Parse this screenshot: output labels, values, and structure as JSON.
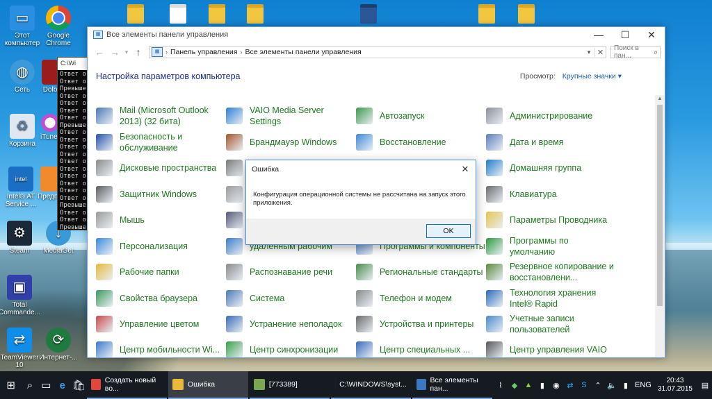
{
  "desktop_icons": [
    {
      "label": "Этот компьютер"
    },
    {
      "label": "Google Chrome"
    },
    {
      "label": "Сеть"
    },
    {
      "label": "Корзина"
    },
    {
      "label": "iTunes"
    },
    {
      "label": "Intel® AT Service ..."
    },
    {
      "label": "Предп..."
    },
    {
      "label": "Steam"
    },
    {
      "label": "MediaGet"
    },
    {
      "label": "Total Commande..."
    },
    {
      "label": "TeamViewer 10"
    },
    {
      "label": "Интернет-..."
    },
    {
      "label": "Dolb"
    }
  ],
  "console": {
    "title": "C:\\Wi",
    "lines": [
      "Ответ о",
      "Ответ о",
      "Превыше",
      "Ответ о",
      "Ответ о",
      "Ответ о",
      "Ответ о",
      "Превыше",
      "Ответ о",
      "Ответ о",
      "Ответ о",
      "Ответ о",
      "Ответ о",
      "Ответ о",
      "Ответ о",
      "Ответ о",
      "Ответ о",
      "Ответ о",
      "Превыше",
      "Ответ о",
      "Ответ о",
      "Превыше"
    ]
  },
  "window": {
    "title": "Все элементы панели управления",
    "address": {
      "crumb1": "Панель управления",
      "crumb2": "Все элементы панели управления"
    },
    "search_placeholder": "Поиск в пан...",
    "heading": "Настройка параметров компьютера",
    "view_label": "Просмотр:",
    "view_value": "Крупные значки"
  },
  "items": [
    {
      "label": "Mail (Microsoft Outlook 2013) (32 бита)",
      "color": "#4a78b5"
    },
    {
      "label": "VAIO Media Server Settings",
      "color": "#2b7fd4"
    },
    {
      "label": "Автозапуск",
      "color": "#3c9a4a"
    },
    {
      "label": "Администрирование",
      "color": "#8a8f99"
    },
    {
      "label": "Безопасность и обслуживание",
      "color": "#2451a8"
    },
    {
      "label": "Брандмауэр Windows",
      "color": "#a6552a"
    },
    {
      "label": "Восстановление",
      "color": "#3d8ad6"
    },
    {
      "label": "Дата и время",
      "color": "#5a7fb8"
    },
    {
      "label": "Дисковые пространства",
      "color": "#8a8a8a"
    },
    {
      "label": "",
      "color": "#777"
    },
    {
      "label": "",
      "color": "#777"
    },
    {
      "label": "Домашняя группа",
      "color": "#1e7bc8"
    },
    {
      "label": "Защитник Windows",
      "color": "#5c5c5c"
    },
    {
      "label": "",
      "color": "#999"
    },
    {
      "label": "",
      "color": "#999"
    },
    {
      "label": "Клавиатура",
      "color": "#6b6b6b"
    },
    {
      "label": "Мышь",
      "color": "#9a9a9a"
    },
    {
      "label": "",
      "color": "#557"
    },
    {
      "label": "",
      "color": "#557"
    },
    {
      "label": "Параметры Проводника",
      "color": "#e8c34a"
    },
    {
      "label": "Персонализация",
      "color": "#3a8ad8"
    },
    {
      "label": "удаленным рабочим",
      "color": "#3a7bc8"
    },
    {
      "label": "Программы и компоненты",
      "color": "#5a8ad0"
    },
    {
      "label": "Программы по умолчанию",
      "color": "#2d9a3c"
    },
    {
      "label": "Рабочие папки",
      "color": "#e6b93b"
    },
    {
      "label": "Распознавание речи",
      "color": "#8a8a8a"
    },
    {
      "label": "Региональные стандарты",
      "color": "#4a8a4a"
    },
    {
      "label": "Резервное копирование и восстановлени...",
      "color": "#5a8a3a"
    },
    {
      "label": "Свойства браузера",
      "color": "#3a9a5a"
    },
    {
      "label": "Система",
      "color": "#4a7ab8"
    },
    {
      "label": "Телефон и модем",
      "color": "#8a8a8a"
    },
    {
      "label": "Технология хранения Intel® Rapid",
      "color": "#2a6ab8"
    },
    {
      "label": "Управление цветом",
      "color": "#c84a4a"
    },
    {
      "label": "Устранение неполадок",
      "color": "#3a6ab8"
    },
    {
      "label": "Устройства и принтеры",
      "color": "#6a6a6a"
    },
    {
      "label": "Учетные записи пользователей",
      "color": "#4a8ac8"
    },
    {
      "label": "Центр мобильности Wi...",
      "color": "#3a7ac8"
    },
    {
      "label": "Центр синхронизации",
      "color": "#3aa04a"
    },
    {
      "label": "Центр специальных ...",
      "color": "#3a6ab8"
    },
    {
      "label": "Центр управления VAIO",
      "color": "#555"
    }
  ],
  "dialog": {
    "title": "Ошибка",
    "message": "Конфигурация операционной системы не рассчитана на запуск этого приложения.",
    "ok": "OK"
  },
  "taskbar": {
    "tasks": [
      {
        "label": "Создать новый во...",
        "color": "#e0473a"
      },
      {
        "label": "Ошибка",
        "color": "#e8b93b"
      },
      {
        "label": "[773389]",
        "color": "#7aa850"
      },
      {
        "label": "C:\\WINDOWS\\syst...",
        "color": "#222"
      },
      {
        "label": "Все элементы пан...",
        "color": "#3a78c2"
      }
    ],
    "lang": "ENG",
    "time": "20:43",
    "date": "31.07.2015"
  }
}
